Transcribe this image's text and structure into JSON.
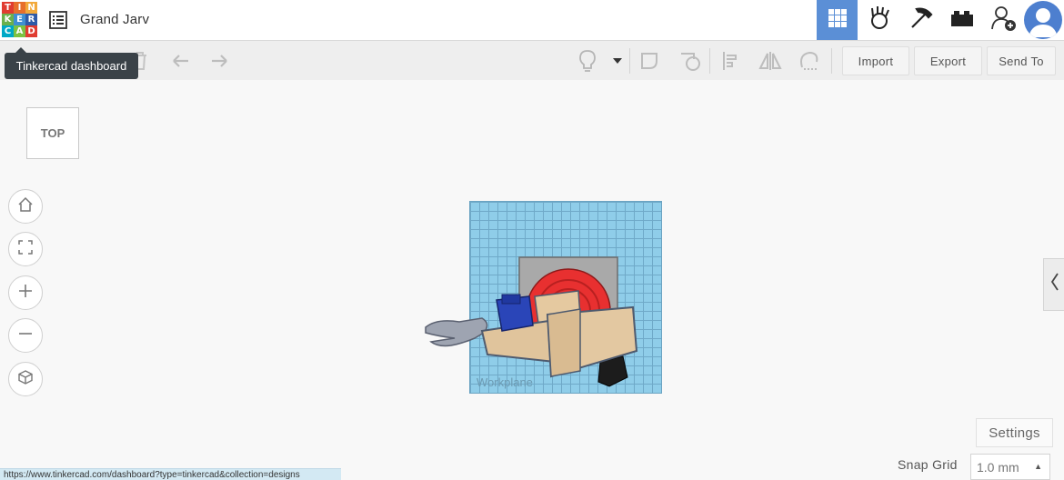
{
  "header": {
    "logo_letters": [
      "T",
      "I",
      "N",
      "K",
      "E",
      "R",
      "C",
      "A",
      "D"
    ],
    "logo_colors": [
      "#e03c31",
      "#e76f2b",
      "#f2a93b",
      "#6ab04c",
      "#3f8fd2",
      "#2e5aa8",
      "#00a8c6",
      "#7cc242",
      "#e03c31"
    ],
    "design_title": "Grand Jarv",
    "buttons": [
      {
        "name": "3d-design-view",
        "icon": "grid-icon",
        "active": true
      },
      {
        "name": "circuits",
        "icon": "circuit-hand-icon",
        "active": false
      },
      {
        "name": "minecraft",
        "icon": "pickaxe-icon",
        "active": false
      },
      {
        "name": "lego-bricks",
        "icon": "brick-icon",
        "active": false
      },
      {
        "name": "add-user",
        "icon": "add-user-icon",
        "active": false
      }
    ],
    "accent": "#5b8fd6"
  },
  "tooltip": {
    "text": "Tinkercad dashboard"
  },
  "toolbar": {
    "import_label": "Import",
    "export_label": "Export",
    "send_to_label": "Send To"
  },
  "viewcube": {
    "label": "TOP"
  },
  "nav_buttons": [
    "home-icon",
    "fit-view-icon",
    "zoom-in-icon",
    "zoom-out-icon",
    "perspective-icon"
  ],
  "workplane": {
    "label": "Workplane",
    "color": "#8fcde9"
  },
  "settings": {
    "label": "Settings"
  },
  "snap_grid": {
    "label": "Snap Grid",
    "value": "1.0 mm"
  },
  "status_url": "https://www.tinkercad.com/dashboard?type=tinkercad&collection=designs"
}
